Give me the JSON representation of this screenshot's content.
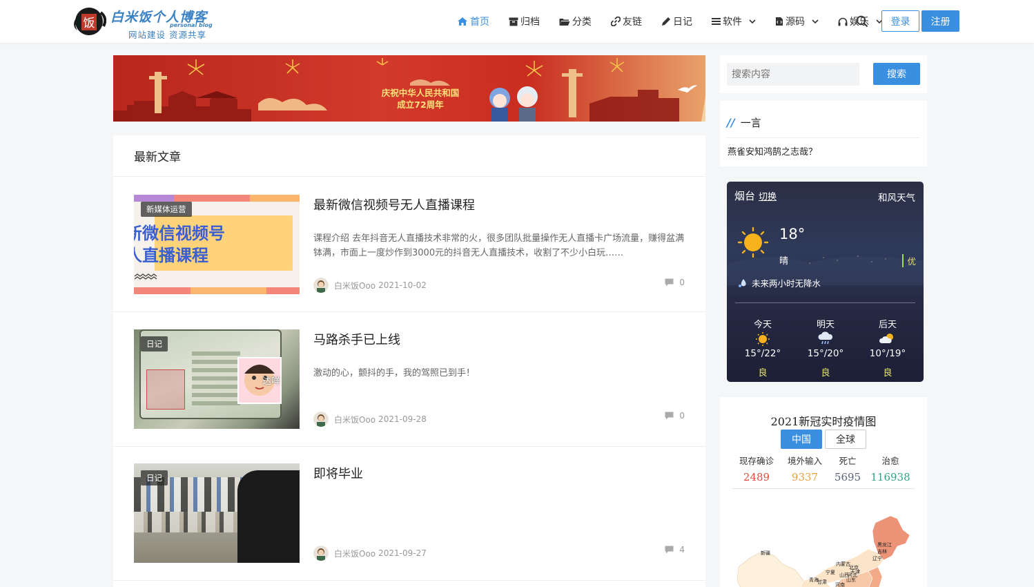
{
  "header": {
    "logo_title": "白米饭个人博客",
    "logo_sub": "personal blog",
    "logo_slogan": "网站建设  资源共享",
    "logo_seal_char": "饭",
    "nav": [
      {
        "label": "首页",
        "icon": "home-icon",
        "active": true
      },
      {
        "label": "归档",
        "icon": "archive-icon"
      },
      {
        "label": "分类",
        "icon": "folder-icon"
      },
      {
        "label": "友链",
        "icon": "link-icon"
      },
      {
        "label": "日记",
        "icon": "pencil-icon"
      },
      {
        "label": "软件",
        "icon": "list-icon",
        "dropdown": true
      },
      {
        "label": "源码",
        "icon": "code-icon",
        "dropdown": true
      },
      {
        "label": "娱乐",
        "icon": "headphones-icon",
        "dropdown": true
      }
    ],
    "login": "登录",
    "register": "注册"
  },
  "banner": {
    "line1": "庆祝中华人民共和国",
    "line2": "成立72周年"
  },
  "articles": {
    "heading": "最新文章",
    "items": [
      {
        "tag": "新媒体运营",
        "title": "最新微信视频号无人直播课程",
        "excerpt": "课程介绍 去年抖音无人直播技术非常的火，很多团队批量操作无人直播卡广场流量，赚得盆满钵满，市面上一度炒作到3000元的抖音无人直播技术，收割了不少小白玩……",
        "author": "白米饭Ooo",
        "date": "2021-10-02",
        "comments": "0",
        "thumb_text1": "新微信视频号",
        "thumb_text2": "人直播课程"
      },
      {
        "tag": "日记",
        "title": "马路杀手已上线",
        "excerpt": "激动的心，颤抖的手，我的驾照已到手！",
        "author": "白米饭Ooo",
        "date": "2021-09-28",
        "comments": "0",
        "thumb_text1": "达咩"
      },
      {
        "tag": "日记",
        "title": "即将毕业",
        "excerpt": "",
        "author": "白米饭Ooo",
        "date": "2021-09-27",
        "comments": "4"
      }
    ]
  },
  "sidebar": {
    "search_placeholder": "搜索内容",
    "search_button": "搜索",
    "yiyan_title": "一言",
    "yiyan_text": "燕雀安知鸿鹄之志哉？",
    "weather": {
      "city": "烟台",
      "switch": "切换",
      "brand": "和风天气",
      "temp": "18°",
      "cond": "晴",
      "aqi": "优",
      "rain": "未来两小时无降水",
      "days": [
        {
          "label": "今天",
          "temp": "15°/22°",
          "aqi": "良",
          "icon": "sun-icon"
        },
        {
          "label": "明天",
          "temp": "15°/20°",
          "aqi": "良",
          "icon": "rain-cloud-icon"
        },
        {
          "label": "后天",
          "temp": "10°/19°",
          "aqi": "良",
          "icon": "partly-cloudy-icon"
        }
      ]
    },
    "covid": {
      "title": "2021新冠实时疫情图",
      "tab_china": "中国",
      "tab_global": "全球",
      "stats": [
        {
          "label": "现存确诊",
          "value": "2489",
          "color": "#e24c3c"
        },
        {
          "label": "境外输入",
          "value": "9337",
          "color": "#e8a13a"
        },
        {
          "label": "死亡",
          "value": "5695",
          "color": "#5b6476"
        },
        {
          "label": "治愈",
          "value": "116938",
          "color": "#2aa586"
        }
      ],
      "map_labels": [
        "黑龙江",
        "吉林",
        "辽宁",
        "新疆",
        "内蒙古",
        "北京",
        "天津",
        "宁夏",
        "山西",
        "河北",
        "山东",
        "青海",
        "甘肃",
        "河南"
      ]
    }
  }
}
